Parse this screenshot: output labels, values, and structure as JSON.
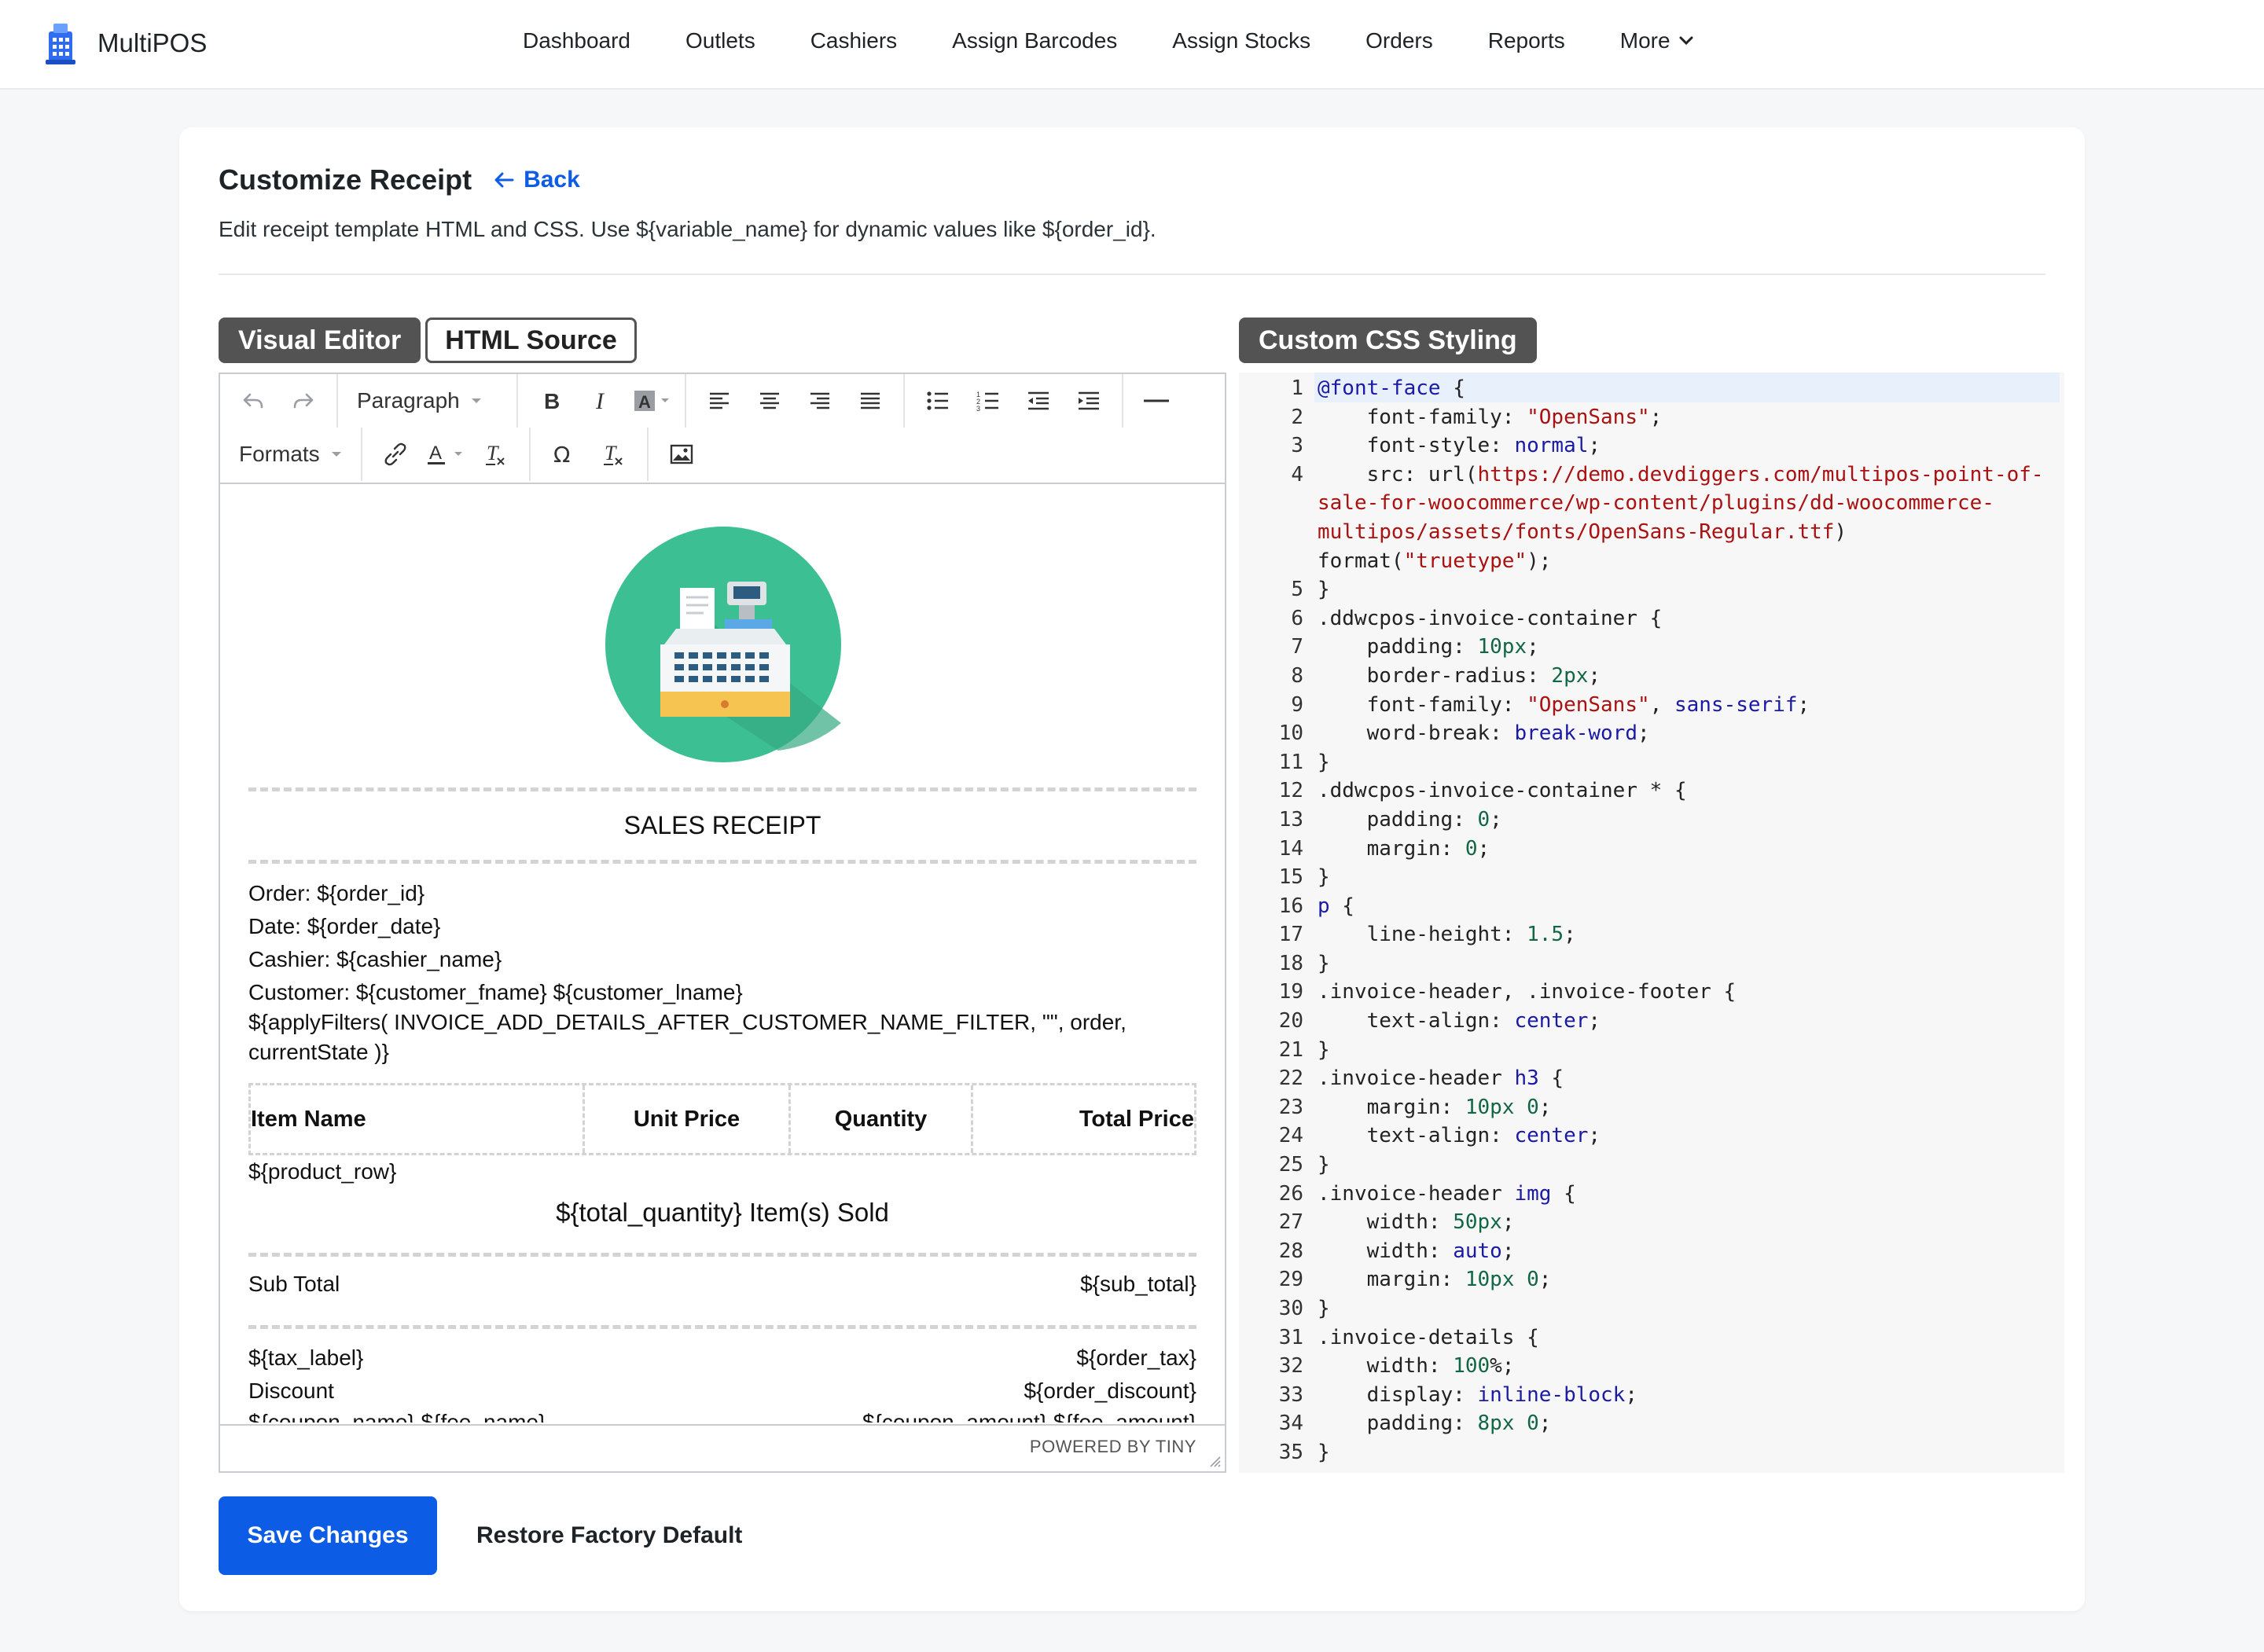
{
  "app": {
    "name": "MultiPOS"
  },
  "nav": {
    "items": [
      "Dashboard",
      "Outlets",
      "Cashiers",
      "Assign Barcodes",
      "Assign Stocks",
      "Orders",
      "Reports"
    ],
    "more_label": "More"
  },
  "page": {
    "title": "Customize Receipt",
    "back_label": "Back",
    "subtitle": "Edit receipt template HTML and CSS. Use ${variable_name} for dynamic values like ${order_id}."
  },
  "tabs": {
    "visual": "Visual Editor",
    "html": "HTML Source",
    "css": "Custom CSS Styling"
  },
  "toolbar": {
    "block_format": "Paragraph",
    "formats": "Formats",
    "icons": [
      "undo-icon",
      "redo-icon",
      "bold-icon",
      "italic-icon",
      "background-color-icon",
      "align-left-icon",
      "align-center-icon",
      "align-right-icon",
      "align-justify-icon",
      "bullet-list-icon",
      "numbered-list-icon",
      "outdent-icon",
      "indent-icon",
      "horizontal-rule-icon",
      "link-icon",
      "text-color-icon",
      "clear-format-icon",
      "special-char-icon",
      "remove-format-icon",
      "image-icon"
    ]
  },
  "receipt": {
    "title": "SALES RECEIPT",
    "lines": [
      "Order: ${order_id}",
      "Date: ${order_date}",
      "Cashier: ${cashier_name}",
      "Customer: ${customer_fname} ${customer_lname}",
      "${applyFilters( INVOICE_ADD_DETAILS_AFTER_CUSTOMER_NAME_FILTER, \"\", order,",
      "currentState )}"
    ],
    "table_headers": [
      "Item Name",
      "Unit Price",
      "Quantity",
      "Total Price"
    ],
    "product_row": "${product_row}",
    "items_sold": "${total_quantity} Item(s) Sold",
    "subtotal": {
      "label": "Sub Total",
      "value": "${sub_total}"
    },
    "tax": {
      "label": "${tax_label}",
      "value": "${order_tax}"
    },
    "discount": {
      "label": "Discount",
      "value": "${order_discount}"
    },
    "coupon": {
      "label": "${coupon_name} ${fee_name}",
      "value": "${coupon_amount} ${fee_amount}"
    }
  },
  "editor_status": {
    "powered": "POWERED BY TINY"
  },
  "css_code": [
    {
      "n": "1",
      "t": "@font-face {"
    },
    {
      "n": "2",
      "t": "    font-family: \"OpenSans\";"
    },
    {
      "n": "3",
      "t": "    font-style: normal;"
    },
    {
      "n": "4",
      "t": "    src: url(https://demo.devdiggers.com/multipos-point-of-"
    },
    {
      "n": "",
      "t": "sale-for-woocommerce/wp-content/plugins/dd-woocommerce-"
    },
    {
      "n": "",
      "t": "multipos/assets/fonts/OpenSans-Regular.ttf)"
    },
    {
      "n": "",
      "t": "format(\"truetype\");"
    },
    {
      "n": "5",
      "t": "}"
    },
    {
      "n": "6",
      "t": ".ddwcpos-invoice-container {"
    },
    {
      "n": "7",
      "t": "    padding: 10px;"
    },
    {
      "n": "8",
      "t": "    border-radius: 2px;"
    },
    {
      "n": "9",
      "t": "    font-family: \"OpenSans\", sans-serif;"
    },
    {
      "n": "10",
      "t": "    word-break: break-word;"
    },
    {
      "n": "11",
      "t": "}"
    },
    {
      "n": "12",
      "t": ".ddwcpos-invoice-container * {"
    },
    {
      "n": "13",
      "t": "    padding: 0;"
    },
    {
      "n": "14",
      "t": "    margin: 0;"
    },
    {
      "n": "15",
      "t": "}"
    },
    {
      "n": "16",
      "t": "p {"
    },
    {
      "n": "17",
      "t": "    line-height: 1.5;"
    },
    {
      "n": "18",
      "t": "}"
    },
    {
      "n": "19",
      "t": ".invoice-header, .invoice-footer {"
    },
    {
      "n": "20",
      "t": "    text-align: center;"
    },
    {
      "n": "21",
      "t": "}"
    },
    {
      "n": "22",
      "t": ".invoice-header h3 {"
    },
    {
      "n": "23",
      "t": "    margin: 10px 0;"
    },
    {
      "n": "24",
      "t": "    text-align: center;"
    },
    {
      "n": "25",
      "t": "}"
    },
    {
      "n": "26",
      "t": ".invoice-header img {"
    },
    {
      "n": "27",
      "t": "    width: 50px;"
    },
    {
      "n": "28",
      "t": "    width: auto;"
    },
    {
      "n": "29",
      "t": "    margin: 10px 0;"
    },
    {
      "n": "30",
      "t": "}"
    },
    {
      "n": "31",
      "t": ".invoice-details {"
    },
    {
      "n": "32",
      "t": "    width: 100%;"
    },
    {
      "n": "33",
      "t": "    display: inline-block;"
    },
    {
      "n": "34",
      "t": "    padding: 8px 0;"
    },
    {
      "n": "35",
      "t": "}"
    }
  ],
  "actions": {
    "save": "Save Changes",
    "restore": "Restore Factory Default"
  },
  "colors": {
    "primary": "#0d5ce6",
    "tab_active": "#535353",
    "logo_teal": "#3dbf94"
  }
}
